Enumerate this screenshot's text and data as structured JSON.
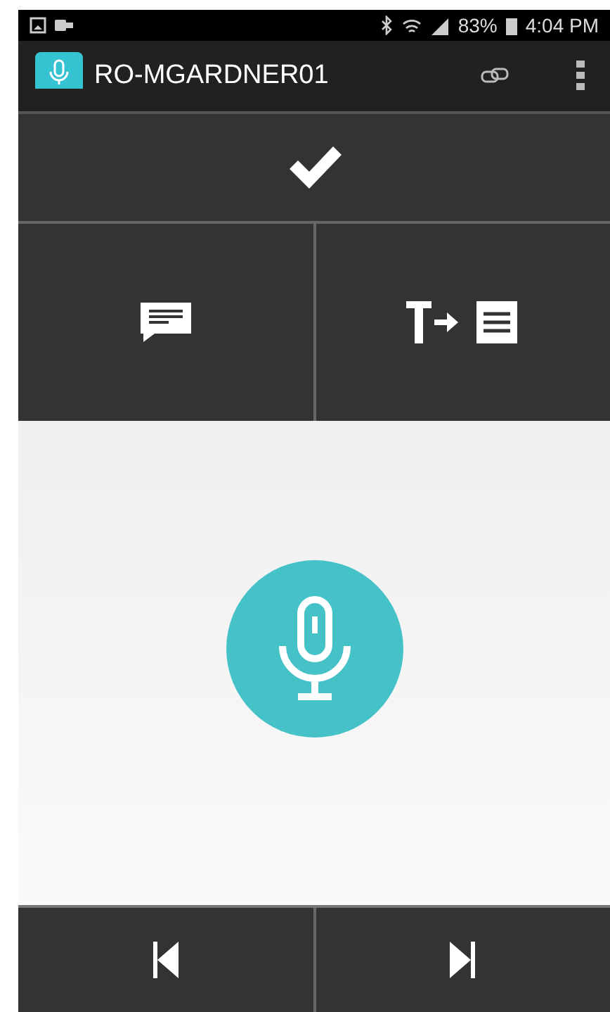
{
  "status_bar": {
    "battery": "83%",
    "time": "4:04 PM"
  },
  "app_bar": {
    "title": "RO-MGARDNER01"
  },
  "actions": [
    {
      "kind": "message"
    },
    {
      "kind": "text-to-document"
    }
  ],
  "record": {
    "kind": "microphone"
  },
  "navigation": [
    {
      "kind": "previous"
    },
    {
      "kind": "next"
    }
  ]
}
